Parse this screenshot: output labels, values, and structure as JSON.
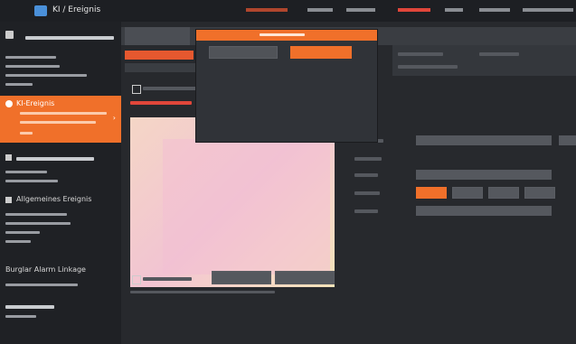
{
  "app": {
    "title": "KI / Ereignis"
  },
  "nav": {
    "items": [
      "",
      "",
      "",
      "",
      "",
      "",
      ""
    ],
    "active_index": 3,
    "accent": "#f0702a"
  },
  "sidebar": {
    "sections": [
      {
        "title": "",
        "items": 3
      },
      {
        "title": "KI-Ereignis",
        "items": 3,
        "active": true
      },
      {
        "title": "",
        "items": 2
      },
      {
        "title": "Allgemeines Ereignis",
        "items": 3
      },
      {
        "title": "Burglar Alarm Linkage",
        "items": 1
      },
      {
        "title": "",
        "items": 1
      }
    ]
  },
  "popup": {
    "title": "",
    "options": [
      "",
      ""
    ],
    "selected_index": 1
  },
  "settings": {
    "checkbox_label": "",
    "lines_label": "",
    "line_buttons": [
      "",
      "",
      "",
      ""
    ],
    "line_selected": 0
  },
  "preview": {
    "display_all_label": "",
    "btn_primary": "",
    "btn_secondary": "",
    "hint": ""
  }
}
